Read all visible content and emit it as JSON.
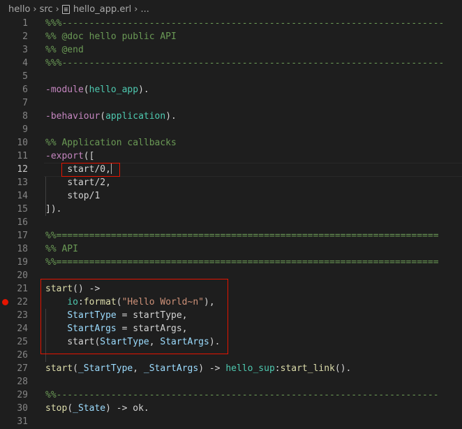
{
  "breadcrumb": {
    "items": [
      "hello",
      "src",
      "hello_app.erl",
      "..."
    ]
  },
  "editor": {
    "line_numbers": [
      "1",
      "2",
      "3",
      "4",
      "5",
      "6",
      "7",
      "8",
      "9",
      "10",
      "11",
      "12",
      "13",
      "14",
      "15",
      "16",
      "17",
      "18",
      "19",
      "20",
      "21",
      "22",
      "23",
      "24",
      "25",
      "26",
      "27",
      "28",
      "29",
      "30",
      "31"
    ],
    "breakpoint_line": "22",
    "lines": {
      "l1": "%%%----------------------------------------------------------------------",
      "l2": "%% @doc hello public API",
      "l3": "%% @end",
      "l4": "%%%----------------------------------------------------------------------",
      "l6_dir": "-module",
      "l6_arg": "hello_app",
      "l8_dir": "-behaviour",
      "l8_arg": "application",
      "l10": "%% Application callbacks",
      "l11_dir": "-export",
      "l12": "start/0,",
      "l13": "start/2,",
      "l14": "stop/1",
      "l17": "%%======================================================================",
      "l18": "%% API",
      "l19": "%%======================================================================",
      "l21_fn": "start",
      "l22_mod": "io",
      "l22_fn": "format",
      "l22_str": "\"Hello World~n\"",
      "l23_var": "StartType",
      "l23_val": "startType",
      "l24_var": "StartArgs",
      "l24_val": "startArgs",
      "l25_fn": "start",
      "l25_a1": "StartType",
      "l25_a2": "StartArgs",
      "l27_fn": "start",
      "l27_a1": "_StartType",
      "l27_a2": "_StartArgs",
      "l27_mod": "hello_sup",
      "l27_call": "start_link",
      "l29": "%%----------------------------------------------------------------------",
      "l30_fn": "stop",
      "l30_a1": "_State",
      "l30_ret": "ok"
    }
  },
  "colors": {
    "background": "#1e1e1e",
    "comment": "#6a9955",
    "directive": "#c586c0",
    "module": "#4ec9b0",
    "function": "#dcdcaa",
    "variable": "#9cdcfe",
    "string": "#ce9178",
    "highlight_box": "#e51400",
    "breakpoint": "#e51400"
  }
}
